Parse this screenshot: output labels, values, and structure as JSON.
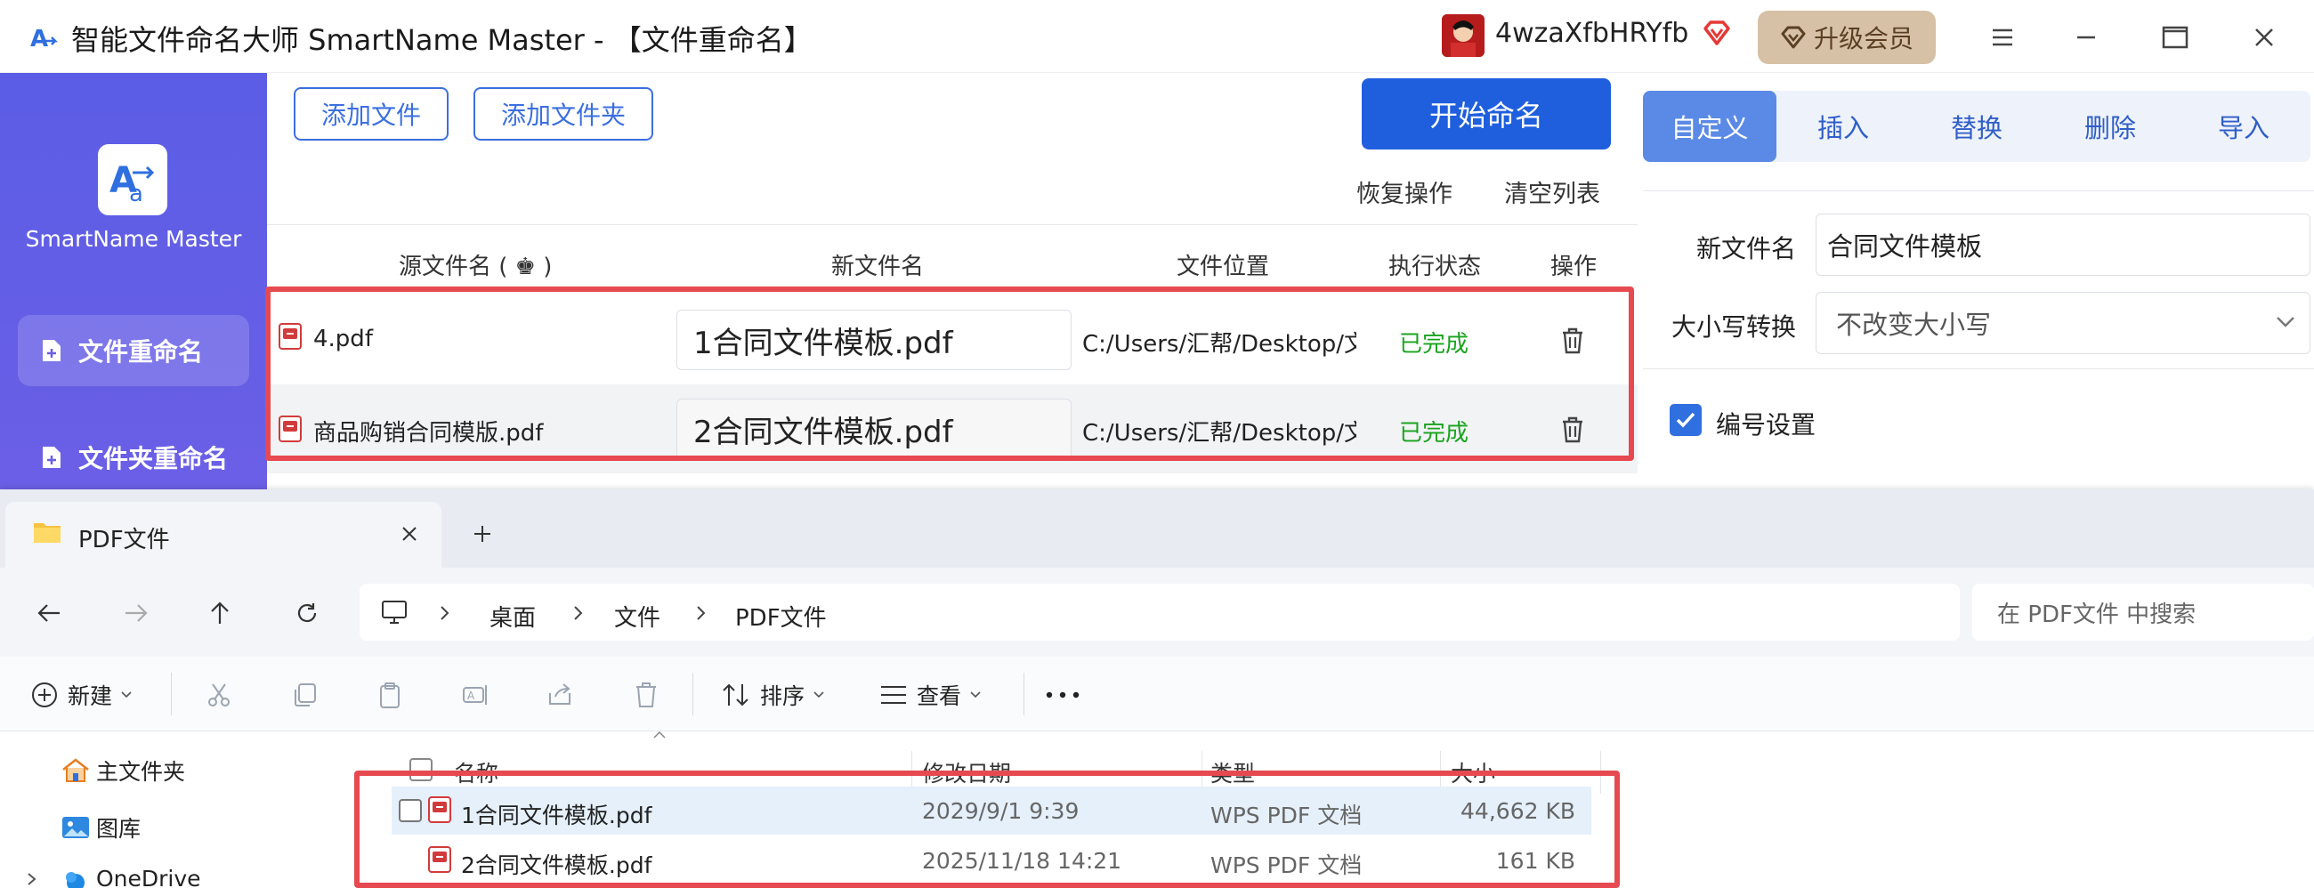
{
  "app": {
    "title": "智能文件命名大师 SmartName Master - 【文件重命名】",
    "user_name": "4wzaXfbHRYfb",
    "upgrade_label": "升级会员",
    "logo_caption": "SmartName Master"
  },
  "sidebar": {
    "items": [
      {
        "label": "文件重命名"
      },
      {
        "label": "文件夹重命名"
      }
    ]
  },
  "toolbar": {
    "add_file": "添加文件",
    "add_folder": "添加文件夹",
    "start_rename": "开始命名",
    "undo": "恢复操作",
    "clear_list": "清空列表"
  },
  "table": {
    "columns": [
      "源文件名 ( ♚ )",
      "新文件名",
      "文件位置",
      "执行状态",
      "操作"
    ],
    "rows": [
      {
        "source": "4.pdf",
        "new_name": "1合同文件模板.pdf",
        "location": "C:/Users/汇帮/Desktop/文件",
        "status": "已完成"
      },
      {
        "source": "商品购销合同模版.pdf",
        "new_name": "2合同文件模板.pdf",
        "location": "C:/Users/汇帮/Desktop/文件",
        "status": "已完成"
      }
    ]
  },
  "right_panel": {
    "tabs": [
      {
        "label": "自定义"
      },
      {
        "label": "插入"
      },
      {
        "label": "替换"
      },
      {
        "label": "删除"
      },
      {
        "label": "导入"
      }
    ],
    "new_name_label": "新文件名",
    "new_name_value": "合同文件模板",
    "case_label": "大小写转换",
    "case_value": "不改变大小写",
    "numbering_label": "编号设置"
  },
  "explorer": {
    "tab_title": "PDF文件",
    "breadcrumb": [
      "桌面",
      "文件",
      "PDF文件"
    ],
    "search_placeholder": "在 PDF文件 中搜索",
    "commands": {
      "new": "新建",
      "sort": "排序",
      "view": "查看"
    },
    "nav_tree": [
      {
        "label": "主文件夹"
      },
      {
        "label": "图库"
      },
      {
        "label": "OneDrive"
      }
    ],
    "columns": [
      "名称",
      "修改日期",
      "类型",
      "大小"
    ],
    "files": [
      {
        "name": "1合同文件模板.pdf",
        "date": "2029/9/1 9:39",
        "type": "WPS PDF 文档",
        "size": "44,662 KB"
      },
      {
        "name": "2合同文件模板.pdf",
        "date": "2025/11/18 14:21",
        "type": "WPS PDF 文档",
        "size": "161 KB"
      }
    ]
  },
  "colors": {
    "sidebar": "#5b5de6",
    "primary": "#1f5fde",
    "success": "#19a31e",
    "highlight_box": "#e6494f"
  }
}
